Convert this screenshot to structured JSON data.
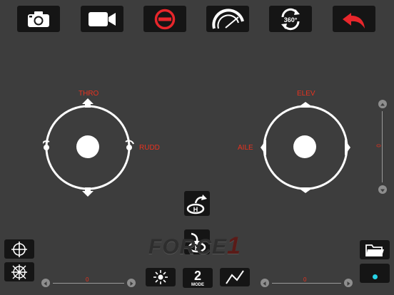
{
  "toolbar": {
    "icons": [
      "camera-icon",
      "video-camera-icon",
      "stop-circle-icon",
      "speedometer-icon",
      "rotate-360-icon",
      "return-arrow-icon"
    ],
    "rotate_label": "360°"
  },
  "left_stick": {
    "top_label": "THRO",
    "right_label": "RUDD"
  },
  "right_stick": {
    "top_label": "ELEV",
    "left_label": "AILE"
  },
  "brand": {
    "prefix": "FORCE",
    "suffix": "1"
  },
  "bottom_toolbar": {
    "mode_number": "2",
    "mode_label": "MODE"
  },
  "trims": {
    "left_horizontal": "0",
    "right_horizontal": "0",
    "right_vertical": "0"
  },
  "colors": {
    "background": "#3d3d3d",
    "button_bg": "#151515",
    "label_red": "#e8321f",
    "accent_cyan": "#27d3e6",
    "stop_red": "#e8262b"
  }
}
